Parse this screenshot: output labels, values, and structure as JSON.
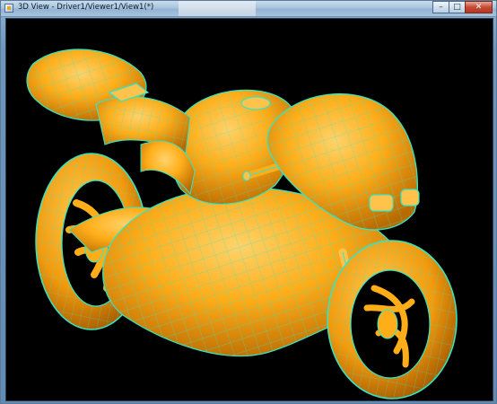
{
  "window": {
    "title": "3D View - Driver1/Viewer1/View1(*)",
    "icon": "app-icon",
    "buttons": [
      {
        "name": "minimize",
        "glyph": "–"
      },
      {
        "name": "maximize",
        "glyph": "□"
      },
      {
        "name": "close",
        "glyph": "✕"
      }
    ]
  },
  "viewport": {
    "background": "#000000",
    "model_color": "#ffae1a",
    "wireframe_color": "#33e6c4"
  }
}
